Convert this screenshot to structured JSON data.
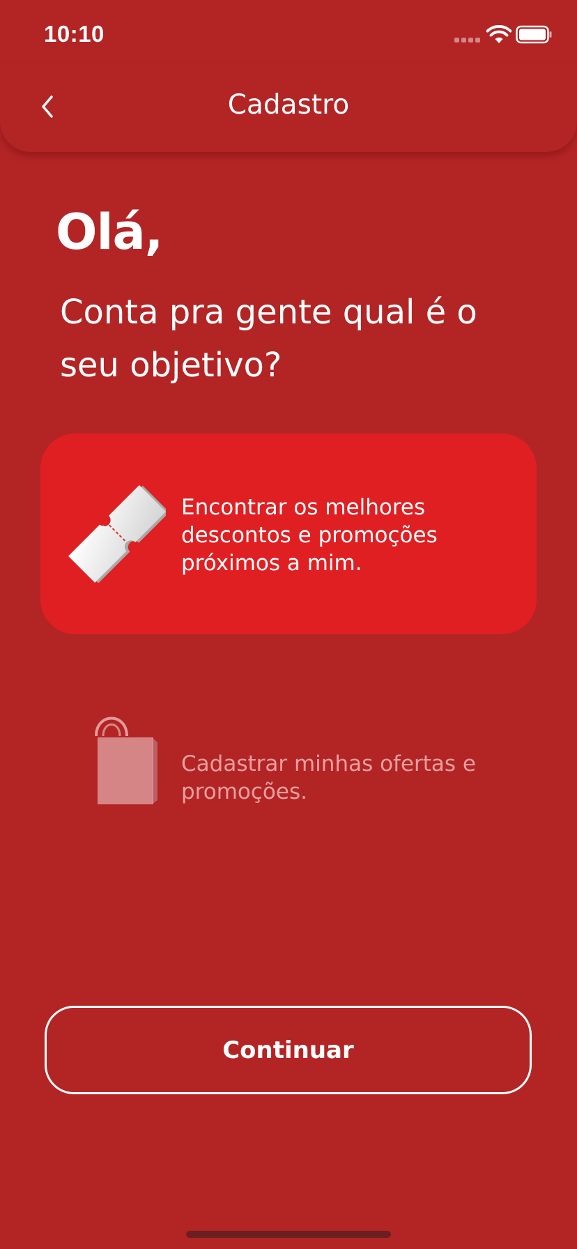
{
  "status_bar": {
    "time": "10:10",
    "signal_icon": "cellular-signal-icon",
    "wifi_icon": "wifi-icon",
    "battery_icon": "battery-full-icon"
  },
  "header": {
    "title": "Cadastro",
    "back_icon": "chevron-left-icon"
  },
  "main": {
    "greeting": "Olá,",
    "question": "Conta pra gente qual é o seu objetivo?",
    "options": [
      {
        "icon": "ticket-icon",
        "label": "Encontrar os melhores descontos e promoções próximos a mim.",
        "selected": true
      },
      {
        "icon": "shopping-bag-icon",
        "label": "Cadastrar minhas ofertas e promoções.",
        "selected": false
      }
    ],
    "continue_label": "Continuar"
  },
  "colors": {
    "background": "#b32425",
    "selected_card": "#e01f22",
    "text": "#ffffff"
  }
}
